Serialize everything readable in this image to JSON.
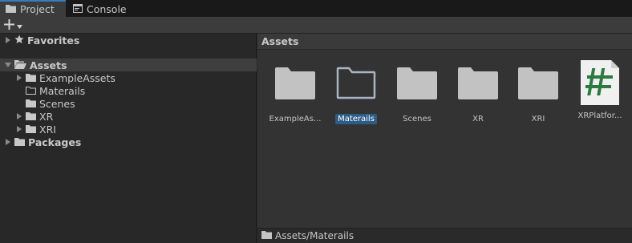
{
  "tabs": [
    {
      "label": "Project",
      "icon": "folder-icon",
      "active": true
    },
    {
      "label": "Console",
      "icon": "console-icon",
      "active": false
    }
  ],
  "toolbar": {
    "add_label": "+"
  },
  "tree": {
    "favorites": "Favorites",
    "assets": "Assets",
    "children": [
      "ExampleAssets",
      "Materails",
      "Scenes",
      "XR",
      "XRI"
    ],
    "packages": "Packages"
  },
  "browser": {
    "header": "Assets",
    "items": [
      {
        "label": "ExampleAs...",
        "type": "folder"
      },
      {
        "label": "Materails",
        "type": "folder-outline",
        "selected": true
      },
      {
        "label": "Scenes",
        "type": "folder"
      },
      {
        "label": "XR",
        "type": "folder"
      },
      {
        "label": "XRI",
        "type": "folder"
      },
      {
        "label": "XRPlatfor...",
        "type": "script"
      }
    ],
    "path": "Assets/Materails"
  },
  "colors": {
    "selection": "#2c5d87",
    "accent": "#3a79bb"
  }
}
